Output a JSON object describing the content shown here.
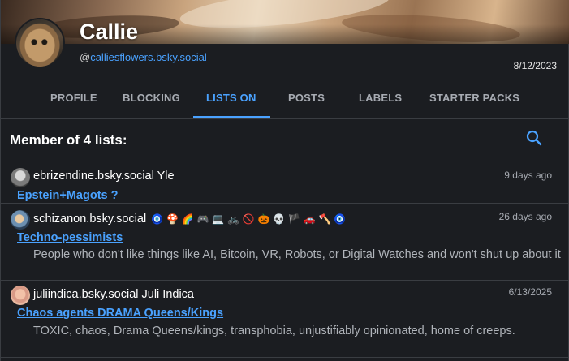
{
  "profile": {
    "display_name": "Callie",
    "handle_prefix": "@",
    "handle": "calliesflowers.bsky.social",
    "joined_date": "8/12/2023"
  },
  "tabs": [
    {
      "label": "PROFILE",
      "active": false
    },
    {
      "label": "BLOCKING",
      "active": false
    },
    {
      "label": "LISTS ON",
      "active": true
    },
    {
      "label": "POSTS",
      "active": false
    },
    {
      "label": "LABELS",
      "active": false
    },
    {
      "label": "STARTER PACKS",
      "active": false
    }
  ],
  "section": {
    "title": "Member of 4 lists:",
    "search_icon": "search-icon"
  },
  "lists": [
    {
      "owner": "ebrizendine.bsky.social Yle",
      "age": "9 days ago",
      "name": "Epstein+Magots ?",
      "description": ""
    },
    {
      "owner": "schizanon.bsky.social",
      "owner_emoji": "🧿 🍄 🌈 🎮 💻 🚲 🚫 🎃 💀 🏴 🚗 🪓 🧿",
      "age": "26 days ago",
      "name": "Techno-pessimists",
      "description": "People who don't like things like AI, Bitcoin, VR, Robots, or Digital Watches and won't shut up about it"
    },
    {
      "owner": "juliindica.bsky.social Juli Indica",
      "age": "6/13/2025",
      "name": "Chaos agents DRAMA Queens/Kings",
      "description": "TOXIC, chaos, Drama Queens/kings, transphobia, unjustifiably opinionated, home of creeps."
    }
  ],
  "colors": {
    "accent": "#4aa2ff",
    "background": "#1b1d21",
    "muted_text": "#a7abb2"
  }
}
